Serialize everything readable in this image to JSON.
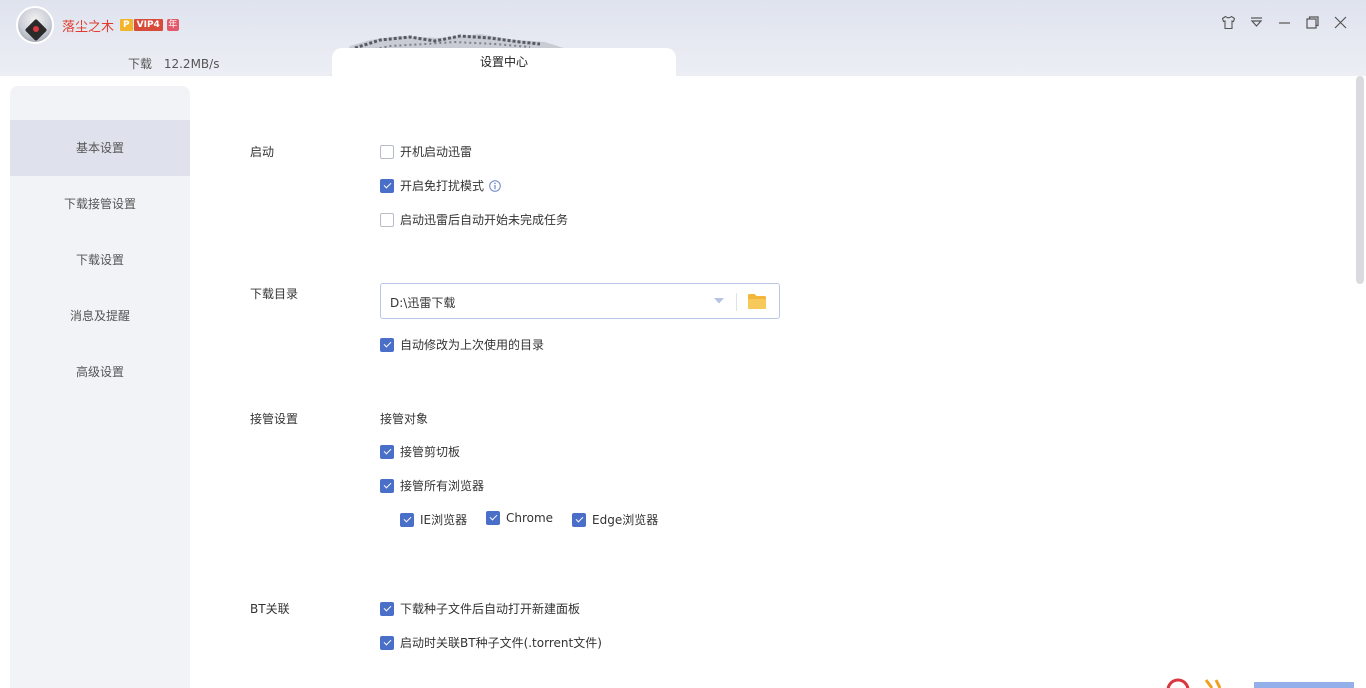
{
  "titlebar": {
    "username": "落尘之木",
    "badge_p": "P",
    "badge_vip": "VIP4",
    "badge_year": "年",
    "icons": [
      "skin-icon",
      "menu-icon",
      "minimize-icon",
      "restore-icon",
      "close-icon"
    ]
  },
  "tabs": {
    "download_label": "下载",
    "download_speed": "12.2MB/s",
    "settings_label": "设置中心"
  },
  "sidebar": {
    "items": [
      {
        "label": "基本设置",
        "active": true
      },
      {
        "label": "下载接管设置",
        "active": false
      },
      {
        "label": "下载设置",
        "active": false
      },
      {
        "label": "消息及提醒",
        "active": false
      },
      {
        "label": "高级设置",
        "active": false
      }
    ]
  },
  "startup": {
    "label": "启动",
    "options": [
      {
        "label": "开机启动迅雷",
        "checked": false
      },
      {
        "label": "开启免打扰模式",
        "checked": true
      },
      {
        "label": "启动迅雷后自动开始未完成任务",
        "checked": false
      }
    ]
  },
  "download_dir": {
    "label": "下载目录",
    "value": "D:\\迅雷下载",
    "auto_modify": {
      "label": "自动修改为上次使用的目录",
      "checked": true
    }
  },
  "takeover": {
    "label": "接管设置",
    "target_heading": "接管对象",
    "clipboard": {
      "label": "接管剪切板",
      "checked": true
    },
    "all_browsers": {
      "label": "接管所有浏览器",
      "checked": true
    },
    "browsers": [
      {
        "label": "IE浏览器",
        "checked": true
      },
      {
        "label": "Chrome",
        "checked": true
      },
      {
        "label": "Edge浏览器",
        "checked": true
      }
    ]
  },
  "bt": {
    "label": "BT关联",
    "options": [
      {
        "label": "下载种子文件后自动打开新建面板",
        "checked": true
      },
      {
        "label": "启动时关联BT种子文件(.torrent文件)",
        "checked": true
      }
    ]
  },
  "colors": {
    "accent": "#4a6fc9",
    "username": "#e23a2d",
    "folder": "#f2b63a"
  }
}
